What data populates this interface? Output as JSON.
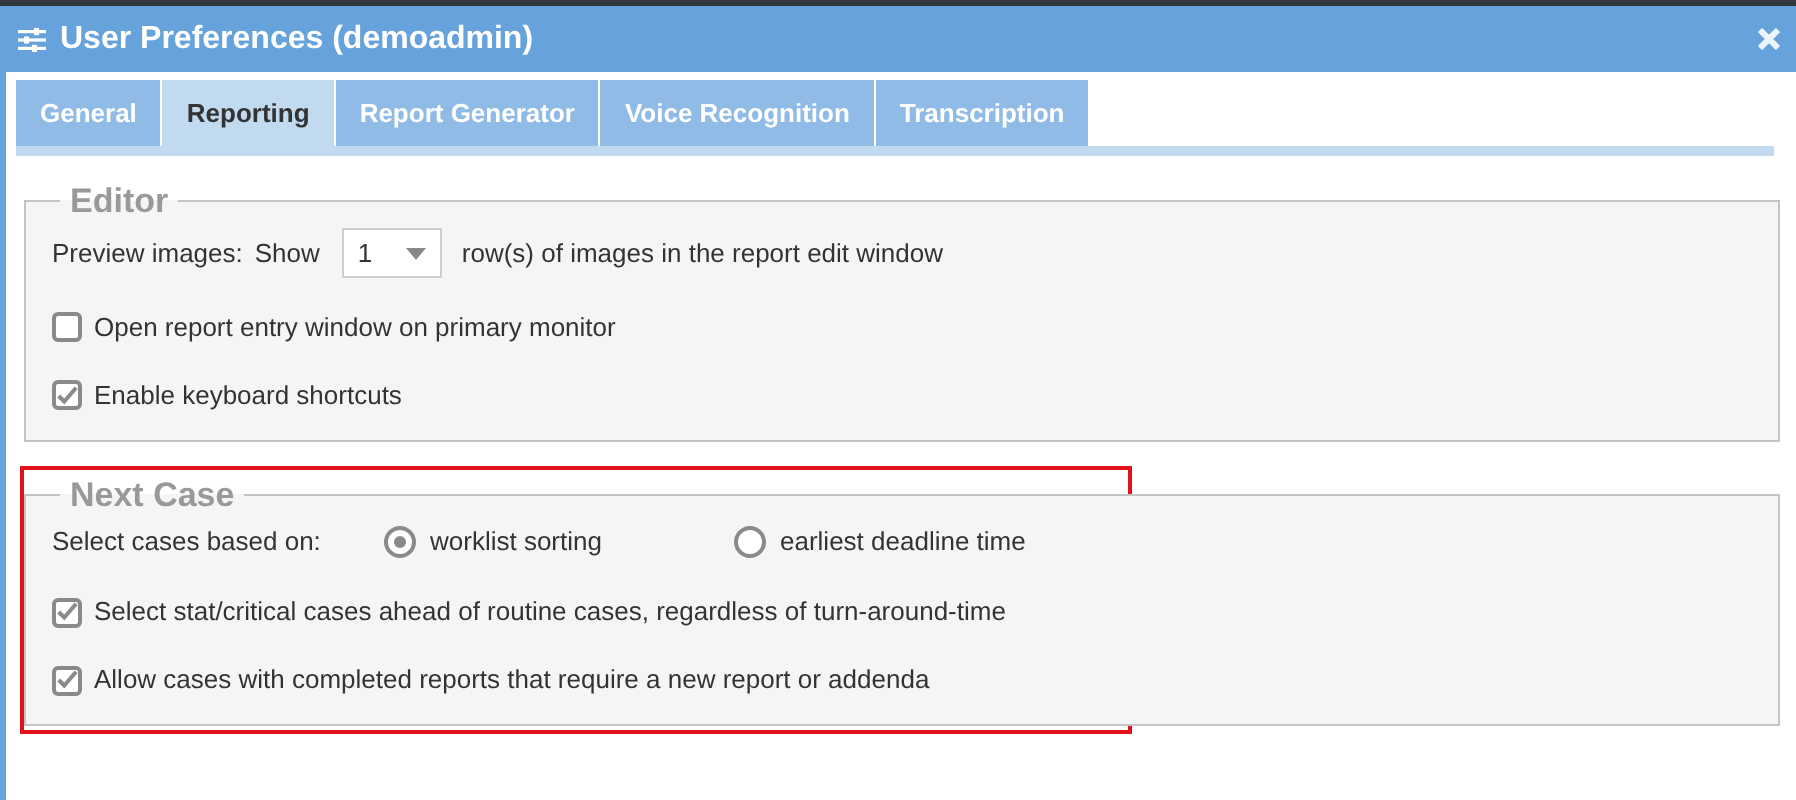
{
  "window": {
    "title": "User Preferences (demoadmin)"
  },
  "tabs": [
    {
      "label": "General",
      "selected": false
    },
    {
      "label": "Reporting",
      "selected": true
    },
    {
      "label": "Report Generator",
      "selected": false
    },
    {
      "label": "Voice Recognition",
      "selected": false
    },
    {
      "label": "Transcription",
      "selected": false
    }
  ],
  "sections": [
    {
      "title": "Editor",
      "highlighted": false,
      "rows": [
        {
          "kind": "select",
          "label": "Preview images:",
          "prefix": "Show",
          "value": "1",
          "suffix": "row(s) of images in the report edit window"
        },
        {
          "kind": "checkbox",
          "label": "Open report entry window on primary monitor",
          "checked": false
        },
        {
          "kind": "checkbox",
          "label": "Enable keyboard shortcuts",
          "checked": true
        }
      ]
    },
    {
      "title": "Next Case",
      "highlighted": true,
      "rows": [
        {
          "kind": "radio",
          "label": "Select cases based on:",
          "options": [
            {
              "label": "worklist sorting",
              "selected": true
            },
            {
              "label": "earliest deadline time",
              "selected": false
            }
          ]
        },
        {
          "kind": "checkbox",
          "label": "Select stat/critical cases ahead of routine cases, regardless of turn-around-time",
          "checked": true
        },
        {
          "kind": "checkbox",
          "label": "Allow cases with completed reports that require a new report or addenda",
          "checked": true
        }
      ]
    }
  ]
}
